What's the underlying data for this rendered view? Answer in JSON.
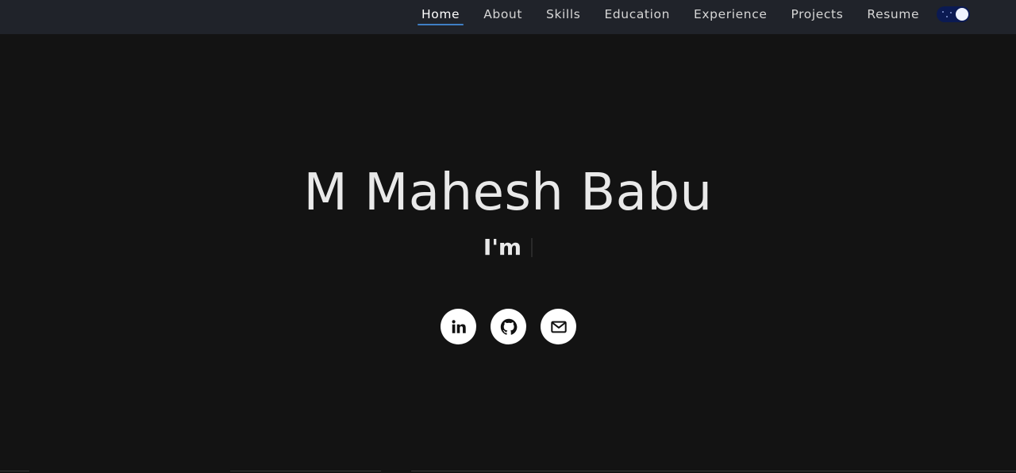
{
  "nav": {
    "items": [
      {
        "label": "Home",
        "active": true,
        "name": "nav-home"
      },
      {
        "label": "About",
        "active": false,
        "name": "nav-about"
      },
      {
        "label": "Skills",
        "active": false,
        "name": "nav-skills"
      },
      {
        "label": "Education",
        "active": false,
        "name": "nav-education"
      },
      {
        "label": "Experience",
        "active": false,
        "name": "nav-experience"
      },
      {
        "label": "Projects",
        "active": false,
        "name": "nav-projects"
      },
      {
        "label": "Resume",
        "active": false,
        "name": "nav-resume"
      }
    ],
    "theme_toggle": {
      "state": "dark",
      "icon": "moon-stars-icon"
    }
  },
  "hero": {
    "name": "M Mahesh Babu",
    "tagline_prefix": "I'm",
    "typed_text": ""
  },
  "socials": [
    {
      "name": "linkedin",
      "icon": "linkedin-icon"
    },
    {
      "name": "github",
      "icon": "github-icon"
    },
    {
      "name": "email",
      "icon": "mail-icon"
    }
  ],
  "colors": {
    "background": "#131313",
    "navbar": "#20232a",
    "active_underline": "#3f7fc4",
    "text": "#e9e9e9",
    "toggle_track": "#0b1a52"
  }
}
